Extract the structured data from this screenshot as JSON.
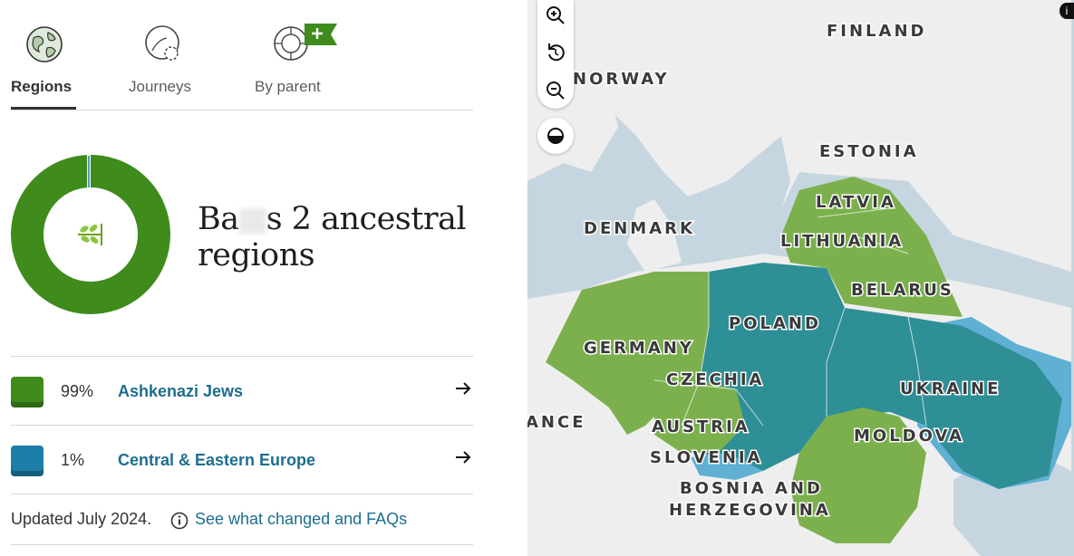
{
  "tabs": [
    {
      "label": "Regions",
      "active": true,
      "icon": "globe-icon"
    },
    {
      "label": "Journeys",
      "active": false,
      "icon": "journeys-icon"
    },
    {
      "label": "By parent",
      "active": false,
      "icon": "by-parent-icon"
    }
  ],
  "summary": {
    "heading_prefix": "Ba",
    "heading_suffix": "s 2 ancestral regions",
    "donut_values": [
      0.99,
      0.01
    ],
    "center_icon": "sprout-icon"
  },
  "regions": [
    {
      "percent": "99%",
      "name": "Ashkenazi Jews",
      "color": "#3f8c1d"
    },
    {
      "percent": "1%",
      "name": "Central & Eastern Europe",
      "color": "#1d7fa8"
    }
  ],
  "updated": {
    "text": "Updated July 2024.",
    "link": "See what changed and FAQs"
  },
  "map": {
    "labels": [
      "FINLAND",
      "NORWAY",
      "ESTONIA",
      "LATVIA",
      "DENMARK",
      "LITHUANIA",
      "BELARUS",
      "POLAND",
      "GERMANY",
      "CZECHIA",
      "UKRAINE",
      "ANCE",
      "AUSTRIA",
      "MOLDOVA",
      "SLOVENIA",
      "BOSNIA AND",
      "HERZEGOVINA"
    ],
    "controls": [
      "zoom-in-icon",
      "reset-icon",
      "zoom-out-icon",
      "contrast-icon"
    ],
    "colors": {
      "water": "#c6d6e0",
      "land": "#eeeeee",
      "green": "#7cb04d",
      "teal": "#2f8f96",
      "light_blue": "#5fb0d3"
    }
  }
}
